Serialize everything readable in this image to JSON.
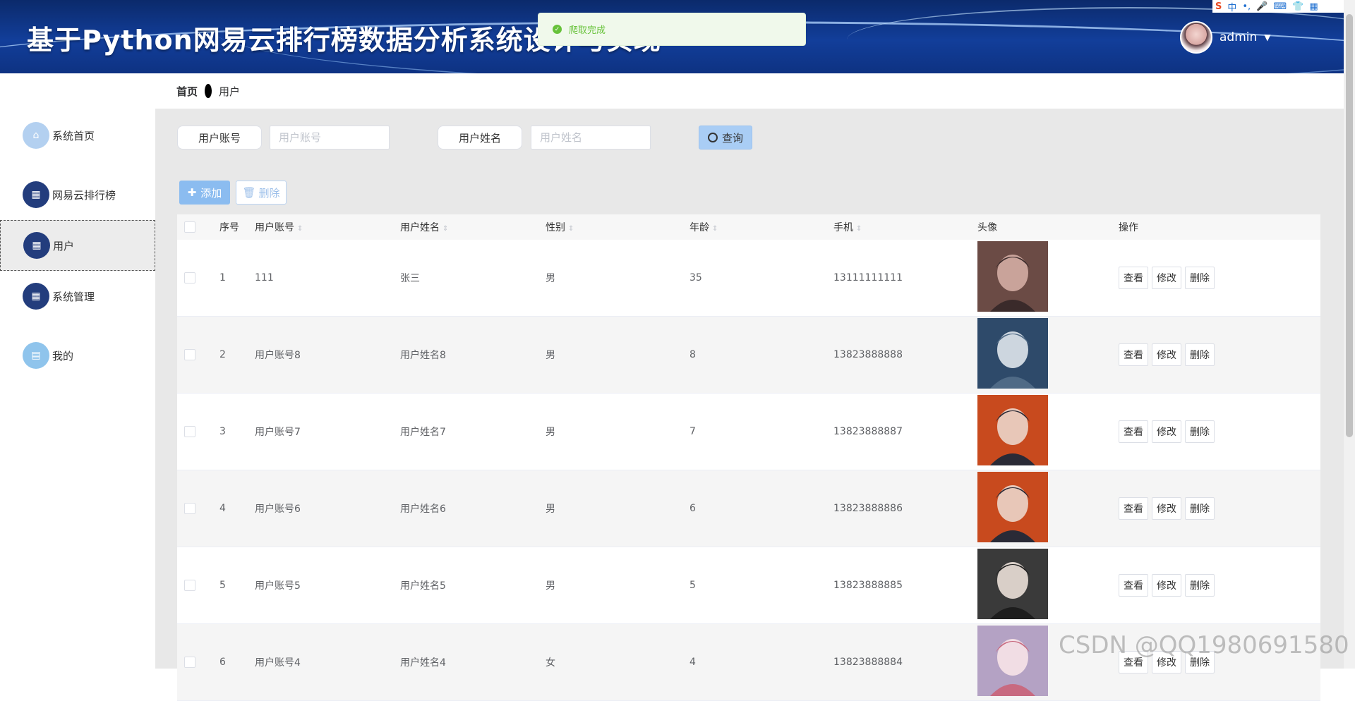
{
  "header": {
    "title": "基于Python网易云排行榜数据分析系统设计与实现",
    "username": "admin",
    "caret": "▼"
  },
  "ime": {
    "logo": "S",
    "items": [
      "中",
      "•,",
      "🎤",
      "⌨",
      "👕",
      "▦"
    ]
  },
  "toast": {
    "message": "爬取完成",
    "icon": "✓"
  },
  "sidebar": {
    "items": [
      {
        "label": "系统首页",
        "icon": "home-icon",
        "glyph": "⌂"
      },
      {
        "label": "网易云排行榜",
        "icon": "grid-icon",
        "glyph": "▦"
      },
      {
        "label": "用户",
        "icon": "grid-icon",
        "glyph": "▦"
      },
      {
        "label": "系统管理",
        "icon": "grid-icon",
        "glyph": "▦"
      },
      {
        "label": "我的",
        "icon": "card-icon",
        "glyph": "▤"
      }
    ]
  },
  "breadcrumb": {
    "home": "首页",
    "current": "用户"
  },
  "search": {
    "account_label": "用户账号",
    "account_placeholder": "用户账号",
    "account_value": "",
    "name_label": "用户姓名",
    "name_placeholder": "用户姓名",
    "name_value": "",
    "query_label": "查询"
  },
  "toolbar": {
    "add_label": "添加",
    "delete_label": "删除"
  },
  "table": {
    "headers": {
      "index": "序号",
      "account": "用户账号",
      "name": "用户姓名",
      "sex": "性别",
      "age": "年龄",
      "phone": "手机",
      "avatar": "头像",
      "ops": "操作"
    },
    "ops": {
      "view": "查看",
      "edit": "修改",
      "delete": "删除"
    },
    "rows": [
      {
        "index": "1",
        "account": "111",
        "name": "张三",
        "sex": "男",
        "age": "35",
        "phone": "13111111111"
      },
      {
        "index": "2",
        "account": "用户账号8",
        "name": "用户姓名8",
        "sex": "男",
        "age": "8",
        "phone": "13823888888"
      },
      {
        "index": "3",
        "account": "用户账号7",
        "name": "用户姓名7",
        "sex": "男",
        "age": "7",
        "phone": "13823888887"
      },
      {
        "index": "4",
        "account": "用户账号6",
        "name": "用户姓名6",
        "sex": "男",
        "age": "6",
        "phone": "13823888886"
      },
      {
        "index": "5",
        "account": "用户账号5",
        "name": "用户姓名5",
        "sex": "男",
        "age": "5",
        "phone": "13823888885"
      },
      {
        "index": "6",
        "account": "用户账号4",
        "name": "用户姓名4",
        "sex": "女",
        "age": "4",
        "phone": "13823888884"
      }
    ]
  },
  "watermark": "CSDN @QQ1980691580",
  "colors": {
    "header": "#123e9a",
    "success": "#67c23a",
    "primary_light": "#8bbcf0",
    "menu_dark": "#233d7d"
  }
}
